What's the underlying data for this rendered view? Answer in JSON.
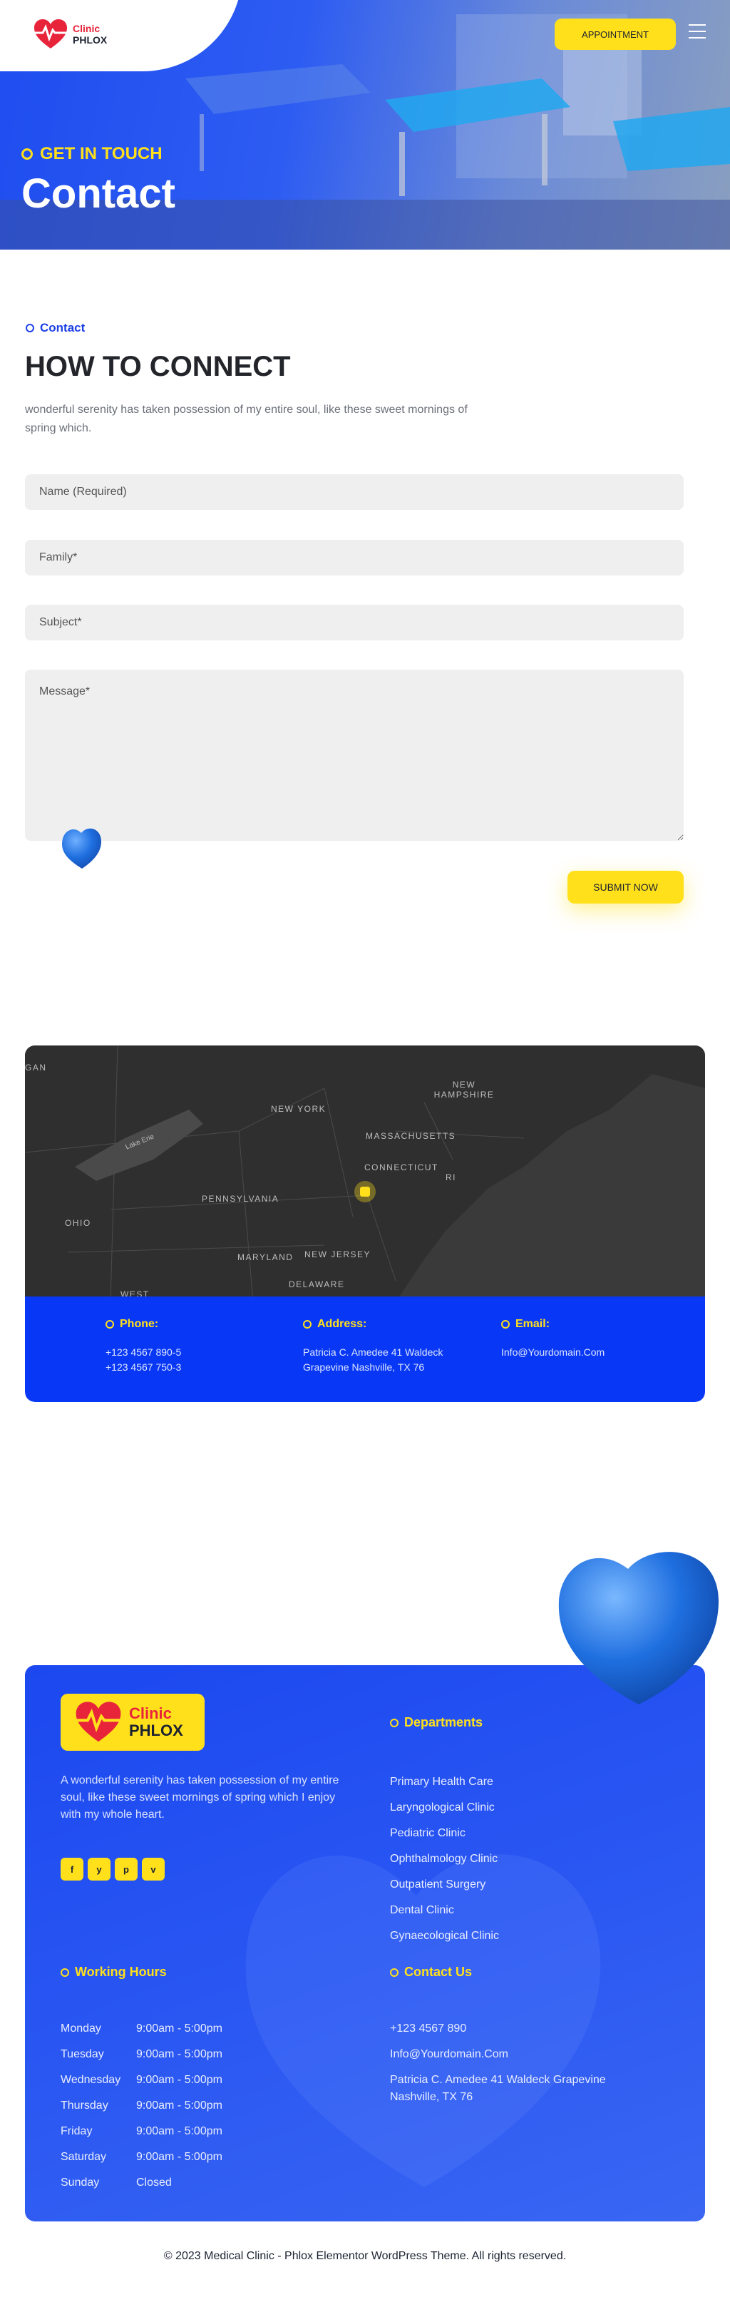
{
  "brand": {
    "name_line1": "Clinic",
    "name_line2": "PHLOX"
  },
  "colors": {
    "primary": "#0838f5",
    "accent": "#ffe01b",
    "logo_red": "#e8243b"
  },
  "header": {
    "appointment_label": "APPOINTMENT",
    "menu_icon": "hamburger-menu-icon"
  },
  "hero": {
    "kicker": "GET IN TOUCH",
    "title": "Contact"
  },
  "form_section": {
    "kicker": "Contact",
    "title": "HOW TO CONNECT",
    "description": "wonderful serenity has taken possession of my entire soul, like these sweet mornings of spring which.",
    "fields": {
      "name_placeholder": "Name (Required)",
      "family_placeholder": "Family*",
      "subject_placeholder": "Subject*",
      "message_placeholder": "Message*"
    },
    "submit_label": "SUBMIT NOW"
  },
  "map": {
    "labels": [
      "GAN",
      "NEW YORK",
      "NEW HAMPSHIRE",
      "MASSACHUSETTS",
      "CONNECTICUT",
      "RI",
      "PENNSYLVANIA",
      "OHIO",
      "MARYLAND",
      "NEW JERSEY",
      "DELAWARE",
      "WEST",
      "Lake Erie"
    ]
  },
  "contact_info": {
    "phone": {
      "title": "Phone:",
      "lines": [
        "+123 4567 890-5",
        "+123 4567 750-3"
      ]
    },
    "address": {
      "title": "Address:",
      "lines": [
        "Patricia C. Amedee 41 Waldeck",
        "Grapevine Nashville, TX 76"
      ]
    },
    "email": {
      "title": "Email:",
      "lines": [
        "Info@Yourdomain.Com"
      ]
    }
  },
  "footer": {
    "description": "A wonderful serenity has taken possession of my entire soul, like these sweet mornings of spring which I enjoy with my whole heart.",
    "socials": [
      {
        "icon": "facebook-icon",
        "glyph": "f"
      },
      {
        "icon": "twitter-icon",
        "glyph": "y"
      },
      {
        "icon": "pinterest-icon",
        "glyph": "p"
      },
      {
        "icon": "vimeo-icon",
        "glyph": "v"
      }
    ],
    "departments_title": "Departments",
    "departments": [
      "Primary Health Care",
      "Laryngological Clinic",
      "Pediatric Clinic",
      "Ophthalmology Clinic",
      "Outpatient Surgery",
      "Dental Clinic",
      "Gynaecological Clinic"
    ],
    "hours_title": "Working Hours",
    "hours": [
      {
        "day": "Monday",
        "time": "9:00am - 5:00pm"
      },
      {
        "day": "Tuesday",
        "time": "9:00am - 5:00pm"
      },
      {
        "day": "Wednesday",
        "time": "9:00am - 5:00pm"
      },
      {
        "day": "Thursday",
        "time": "9:00am - 5:00pm"
      },
      {
        "day": "Friday",
        "time": "9:00am - 5:00pm"
      },
      {
        "day": "Saturday",
        "time": "9:00am - 5:00pm"
      },
      {
        "day": "Sunday",
        "time": "Closed"
      }
    ],
    "contact_title": "Contact Us",
    "contact_phone": "+123 4567 890",
    "contact_email": "Info@Yourdomain.Com",
    "contact_address": "Patricia C. Amedee 41 Waldeck Grapevine Nashville, TX 76"
  },
  "copyright": "© 2023 Medical Clinic - Phlox Elementor WordPress Theme. All rights reserved."
}
